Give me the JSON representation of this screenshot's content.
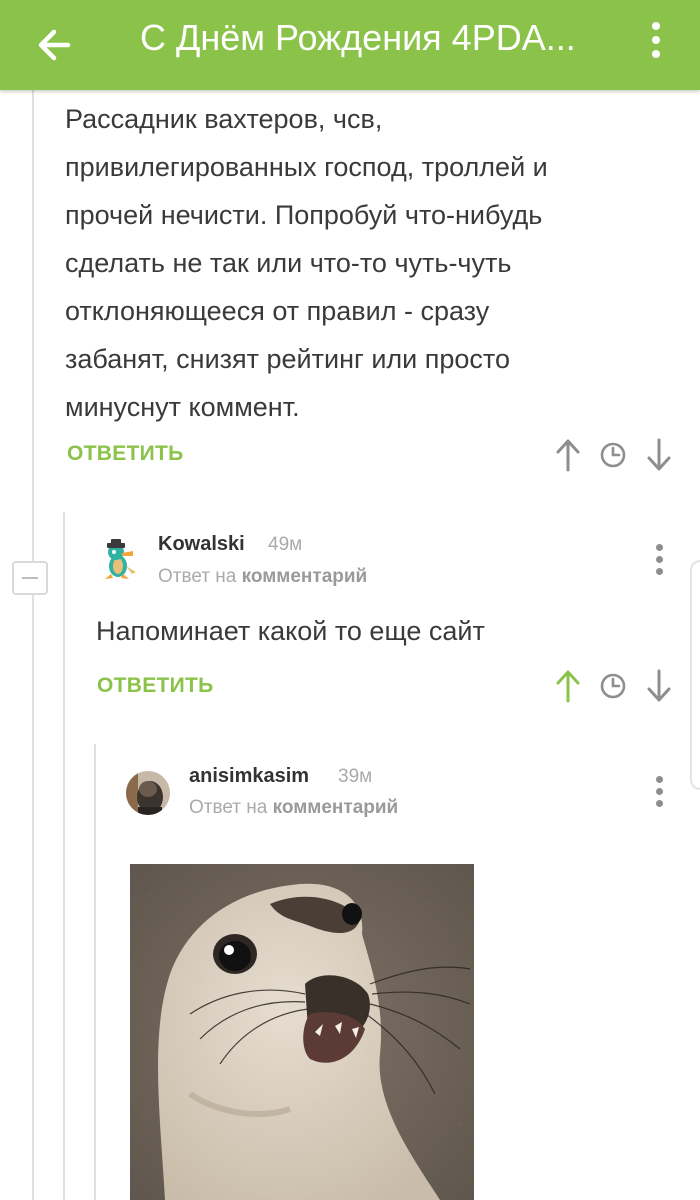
{
  "appbar": {
    "title": "С Днём Рождения 4PDA...",
    "back_icon": "arrow-left-icon",
    "menu_icon": "more-vertical-icon",
    "color": "#8bc34a"
  },
  "comment1": {
    "cut_line": "",
    "text_lines": [
      "Рассадник вахтеров, чсв,",
      "привилегированных господ, троллей и",
      "прочей нечисти. Попробуй что-нибудь",
      "сделать не так или что-то чуть-чуть",
      "отклоняющееся от правил - сразу",
      "забанят, снизят рейтинг или просто",
      "минуснут коммент."
    ],
    "reply_label": "ОТВЕТИТЬ"
  },
  "comment2": {
    "username": "Kowalski",
    "time": "49м",
    "reply_to_prefix": "Ответ на",
    "reply_to_target": "комментарий",
    "text": "Напоминает какой то еще сайт",
    "reply_label": "ОТВЕТИТЬ",
    "upvoted": true
  },
  "comment3": {
    "username": "anisimkasim",
    "time": "39м",
    "reply_to_prefix": "Ответ на",
    "reply_to_target": "комментарий",
    "image": "seal-meme-image"
  },
  "colors": {
    "accent": "#8bc34a",
    "icon_gray": "#8e8e8e"
  }
}
